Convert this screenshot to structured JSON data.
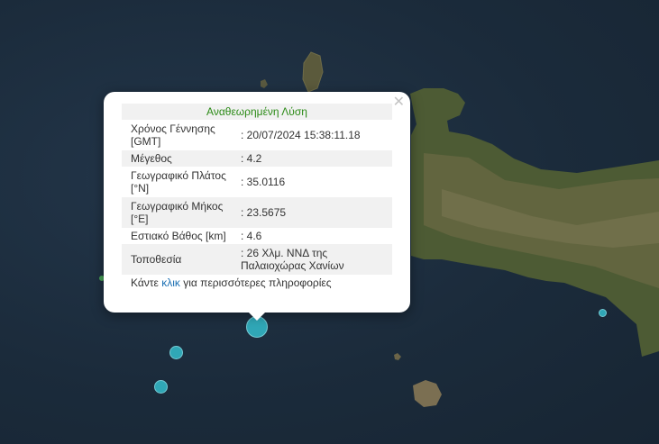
{
  "popup": {
    "title": "Αναθεωρημένη Λύση",
    "rows": [
      {
        "label": "Χρόνος Γέννησης [GMT]",
        "value": ": 20/07/2024 15:38:11.18"
      },
      {
        "label": "Μέγεθος",
        "value": ": 4.2"
      },
      {
        "label": "Γεωγραφικό Πλάτος [°N]",
        "value": ": 35.0116"
      },
      {
        "label": "Γεωγραφικό Μήκος [°E]",
        "value": ": 23.5675"
      },
      {
        "label": "Εστιακό Βάθος [km]",
        "value": ": 4.6"
      },
      {
        "label": "Τοποθεσία",
        "value": ": 26 Χλμ. ΝΝΔ της Παλαιοχώρας Χανίων"
      }
    ],
    "footer_prefix": "Κάντε ",
    "footer_link": "κλικ",
    "footer_suffix": " για περισσότερες πληροφορίες",
    "close_icon": "close-icon"
  },
  "colors": {
    "sea": "#1d2d3b",
    "marker": "#33b5c4",
    "title_green": "#2b8a16",
    "link_blue": "#1a6fb3"
  }
}
